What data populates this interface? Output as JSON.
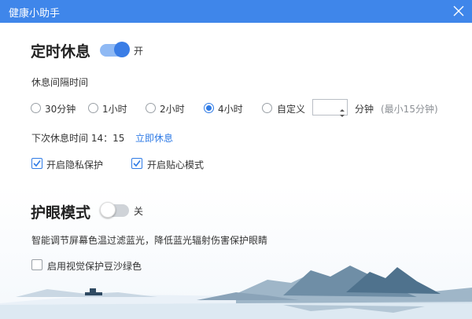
{
  "window": {
    "title": "健康小助手",
    "close_icon": "close-icon"
  },
  "rest": {
    "title": "定时休息",
    "toggle_state": "on",
    "toggle_label": "开",
    "interval_label": "休息间隔时间",
    "options": [
      {
        "label": "30分钟",
        "checked": false
      },
      {
        "label": "1小时",
        "checked": false
      },
      {
        "label": "2小时",
        "checked": false
      },
      {
        "label": "4小时",
        "checked": true
      },
      {
        "label": "自定义",
        "checked": false
      }
    ],
    "custom_value": "",
    "custom_unit": "分钟",
    "custom_hint": "(最小15分钟)",
    "next_rest_label": "下次休息时间 14：15",
    "rest_now_link": "立即休息",
    "privacy": {
      "label": "开启隐私保护",
      "checked": true
    },
    "caring": {
      "label": "开启贴心模式",
      "checked": true
    }
  },
  "eye": {
    "title": "护眼模式",
    "toggle_state": "off",
    "toggle_label": "关",
    "description": "智能调节屏幕色温过滤蓝光，降低蓝光辐射伤害保护眼睛",
    "green_bg": {
      "label": "启用视觉保护豆沙绿色",
      "checked": false
    }
  },
  "colors": {
    "accent": "#3f86ea",
    "toggle_on": "#3a7de6",
    "link": "#2f7be6"
  }
}
